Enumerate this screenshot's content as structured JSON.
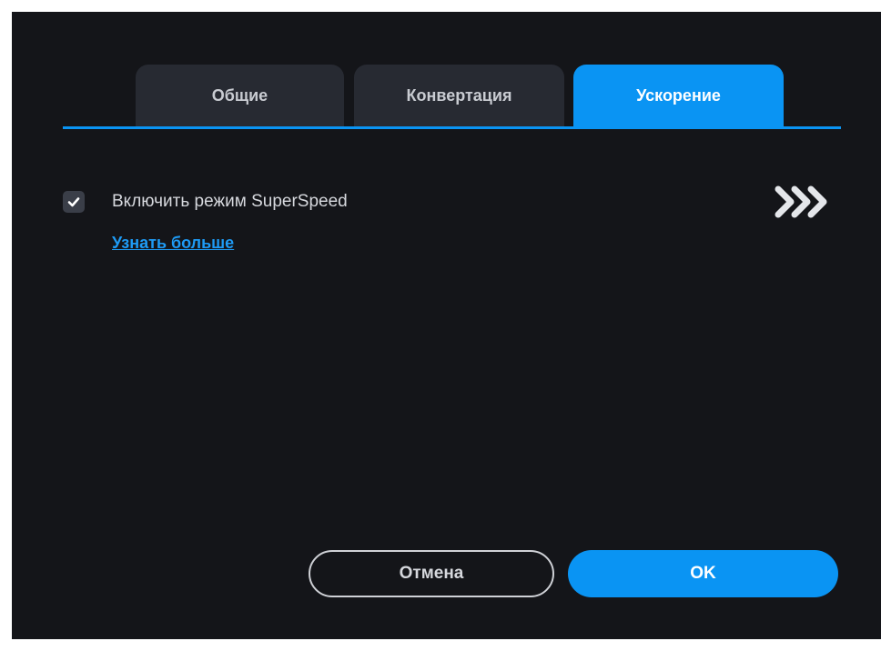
{
  "tabs": [
    {
      "label": "Общие",
      "active": false
    },
    {
      "label": "Конвертация",
      "active": false
    },
    {
      "label": "Ускорение",
      "active": true
    }
  ],
  "acceleration": {
    "superspeed_label": "Включить режим SuperSpeed",
    "superspeed_checked": true,
    "learn_more_link": "Узнать больше",
    "speed_icon": "triple-chevron-right-icon"
  },
  "buttons": {
    "cancel_label": "Отмена",
    "ok_label": "OK"
  },
  "colors": {
    "accent": "#0a94f3",
    "background": "#141519",
    "tab_inactive": "#272a32",
    "link": "#1e9bf5"
  }
}
